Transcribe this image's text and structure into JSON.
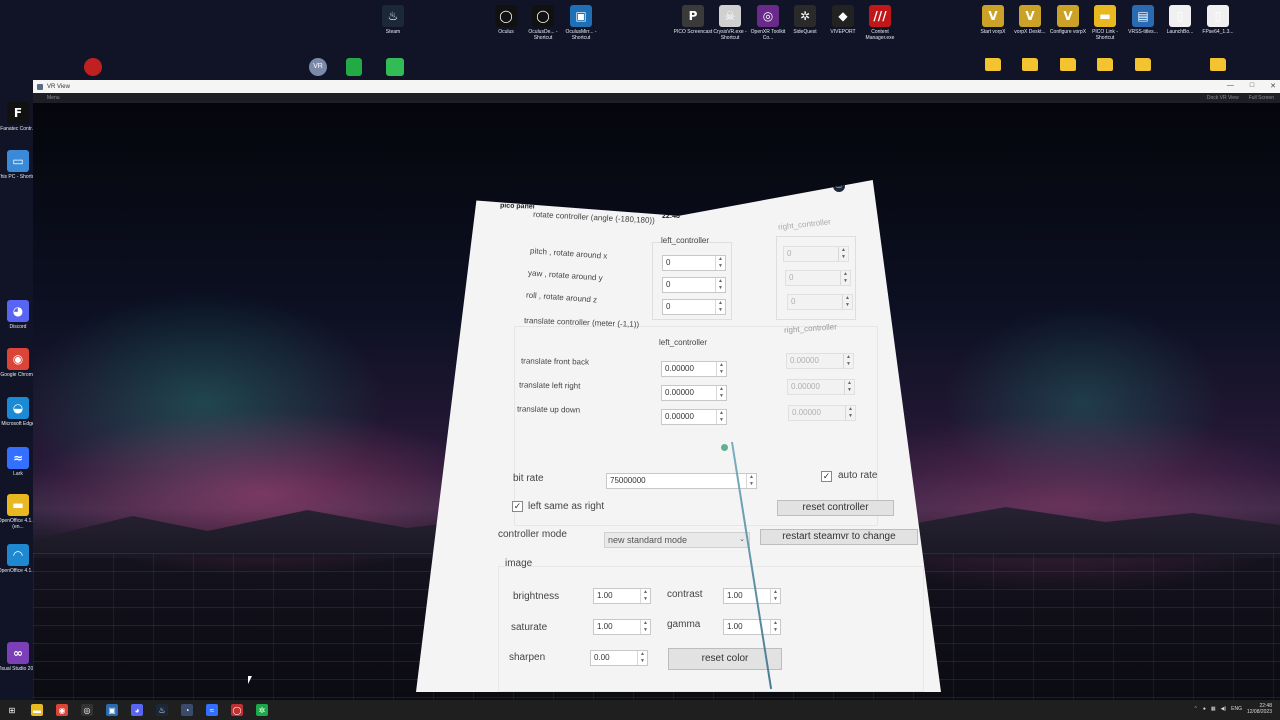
{
  "desktop": {
    "top_icons": [
      {
        "name": "steam-desktop-icon",
        "label": "Steam",
        "glyph": "♨",
        "color": "#1b2838"
      },
      {
        "name": "oculus-desktop-icon",
        "label": "Oculus",
        "glyph": "◯",
        "color": "#111111"
      },
      {
        "name": "oculus-debug-shortcut-icon",
        "label": "OculusDe... - Shortcut",
        "glyph": "◯",
        "color": "#111111"
      },
      {
        "name": "oculus-mirror-shortcut-icon",
        "label": "OculusMirr... - Shortcut",
        "glyph": "▣",
        "color": "#1e6fb5"
      },
      {
        "name": "pico-screencast-icon",
        "label": "PICO Screencast",
        "glyph": "P",
        "color": "#3a3a3a"
      },
      {
        "name": "crysisvr-shortcut-icon",
        "label": "CrysisVR.exe - Shortcut",
        "glyph": "☠",
        "color": "#d0d0d0"
      },
      {
        "name": "openxr-toolkit-icon",
        "label": "OpenXR Toolkit Co...",
        "glyph": "◎",
        "color": "#6a2a8a"
      },
      {
        "name": "sidequest-icon",
        "label": "SideQuest",
        "glyph": "✲",
        "color": "#2a2a2a"
      },
      {
        "name": "viveport-icon",
        "label": "VIVEPORT",
        "glyph": "◆",
        "color": "#222222"
      },
      {
        "name": "content-manager-icon",
        "label": "Content Manager.exe",
        "glyph": "///",
        "color": "#c01818"
      },
      {
        "name": "start-vorpx-icon",
        "label": "Start vorpX",
        "glyph": "V",
        "color": "#c9a227"
      },
      {
        "name": "vorpx-desktop-icon",
        "label": "vorpX Deskt...",
        "glyph": "V",
        "color": "#c9a227"
      },
      {
        "name": "configure-vorpx-icon",
        "label": "Configure vorpX",
        "glyph": "V",
        "color": "#c9a227"
      },
      {
        "name": "pico-link-shortcut-icon",
        "label": "PICO Link - Shortcut",
        "glyph": "▬",
        "color": "#e8b820"
      },
      {
        "name": "vrss-titles-icon",
        "label": "VRSS-titles...",
        "glyph": "▤",
        "color": "#2a6ab0"
      },
      {
        "name": "launchbo-icon",
        "label": "LaunchBo...",
        "glyph": "▯",
        "color": "#f0f0f0"
      },
      {
        "name": "fpse64-icon",
        "label": "FPse64_1.3...",
        "glyph": "▯",
        "color": "#f0f0f0"
      }
    ],
    "left_icons": [
      {
        "name": "fanatec-control-icon",
        "label": "Fanatec Contr...",
        "glyph": "F",
        "color": "#111111"
      },
      {
        "name": "this-pc-shortcut-icon",
        "label": "This PC - Shortcut",
        "glyph": "▭",
        "color": "#3a8ad8"
      },
      {
        "name": "discord-icon",
        "label": "Discord",
        "glyph": "◕",
        "color": "#5865f2"
      },
      {
        "name": "google-chrome-icon",
        "label": "Google Chrome",
        "glyph": "◉",
        "color": "#db4437"
      },
      {
        "name": "microsoft-edge-icon",
        "label": "Microsoft Edge",
        "glyph": "◒",
        "color": "#1a8ad4"
      },
      {
        "name": "lark-icon",
        "label": "Lark",
        "glyph": "≈",
        "color": "#3370ff"
      },
      {
        "name": "openoffice-folder-icon",
        "label": "OpenOffice 4.1.14 (en...",
        "glyph": "▬",
        "color": "#e8b820"
      },
      {
        "name": "openoffice-icon",
        "label": "OpenOffice 4.1.14",
        "glyph": "◠",
        "color": "#1e88d0"
      },
      {
        "name": "visual-studio-icon",
        "label": "Visual Studio 2022",
        "glyph": "∞",
        "color": "#7b3fb8"
      }
    ]
  },
  "window": {
    "title": "VR View",
    "menu": "Menu",
    "dock_view": "Dock VR View",
    "full_screen": "Full Screen",
    "min": "—",
    "max": "□",
    "close": "✕"
  },
  "panel": {
    "title": "pico panel",
    "time": "22:48",
    "rotate": {
      "header": "rotate controller  (angle (-180,180))",
      "left_header": "left_controller",
      "right_header": "right_controller",
      "rows": [
        {
          "label": "pitch , rotate around x",
          "left": "0",
          "right": "0"
        },
        {
          "label": "yaw , rotate around y",
          "left": "0",
          "right": "0"
        },
        {
          "label": "roll , rotate around z",
          "left": "0",
          "right": "0"
        }
      ]
    },
    "translate": {
      "header": "translate controller (meter (-1,1))",
      "left_header": "left_controller",
      "right_header": "right_controller",
      "rows": [
        {
          "label": "translate front back",
          "left": "0.00000",
          "right": "0.00000"
        },
        {
          "label": "translate left right",
          "left": "0.00000",
          "right": "0.00000"
        },
        {
          "label": "translate up down",
          "left": "0.00000",
          "right": "0.00000"
        }
      ]
    },
    "bit_rate_label": "bit rate",
    "bit_rate_value": "75000000",
    "auto_rate_label": "auto rate",
    "auto_rate_checked": "✓",
    "left_same_label": "left same as right",
    "left_same_checked": "✓",
    "reset_controller": "reset controller",
    "controller_mode_label": "controller mode",
    "controller_mode_value": "new standard mode",
    "restart_button": "restart steamvr to change",
    "image": {
      "header": "image",
      "brightness_label": "brightness",
      "brightness": "1.00",
      "contrast_label": "contrast",
      "contrast": "1.00",
      "saturate_label": "saturate",
      "saturate": "1.00",
      "gamma_label": "gamma",
      "gamma": "1.00",
      "sharpen_label": "sharpen",
      "sharpen": "0.00",
      "reset_color": "reset color"
    }
  },
  "taskbar": {
    "apps": [
      {
        "name": "start-button-icon",
        "glyph": "⊞",
        "color": "#1f1f1f"
      },
      {
        "name": "file-explorer-icon",
        "glyph": "▬",
        "color": "#e8b820"
      },
      {
        "name": "chrome-taskbar-icon",
        "glyph": "◉",
        "color": "#db4437"
      },
      {
        "name": "obs-taskbar-icon",
        "glyph": "◎",
        "color": "#333333"
      },
      {
        "name": "screenshot-taskbar-icon",
        "glyph": "▣",
        "color": "#2a6ab0"
      },
      {
        "name": "discord-taskbar-icon",
        "glyph": "◕",
        "color": "#5865f2"
      },
      {
        "name": "steam-taskbar-icon",
        "glyph": "♨",
        "color": "#1b2838"
      },
      {
        "name": "steamvr-taskbar-icon",
        "glyph": "◔",
        "color": "#3a4a6a"
      },
      {
        "name": "lark-taskbar-icon",
        "glyph": "≈",
        "color": "#3370ff"
      },
      {
        "name": "oculus-taskbar-icon",
        "glyph": "◯",
        "color": "#c03030"
      },
      {
        "name": "sidequest-taskbar-icon",
        "glyph": "✲",
        "color": "#1fa84a"
      }
    ],
    "language": "ENG",
    "time": "22:48",
    "date": "12/08/2023"
  }
}
